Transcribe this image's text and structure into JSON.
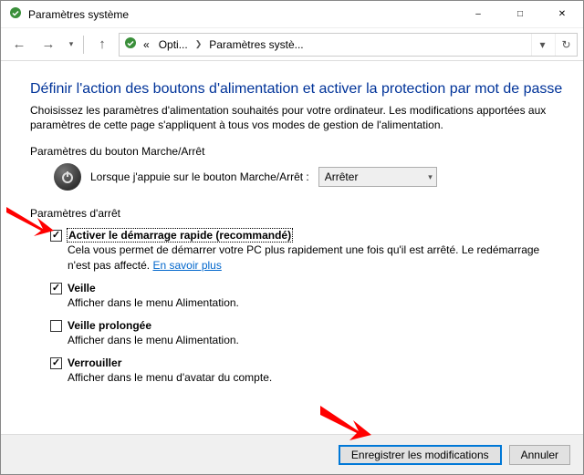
{
  "window": {
    "title": "Paramètres système"
  },
  "breadcrumb": {
    "item0": "Opti...",
    "item1": "Paramètres systè..."
  },
  "page": {
    "heading": "Définir l'action des boutons d'alimentation et activer la protection par mot de passe",
    "intro": "Choisissez les paramètres d'alimentation souhaités pour votre ordinateur. Les modifications apportées aux paramètres de cette page s'appliquent à tous vos modes de gestion de l'alimentation."
  },
  "powerButton": {
    "sectionLabel": "Paramètres du bouton Marche/Arrêt",
    "rowLabel": "Lorsque j'appuie sur le bouton Marche/Arrêt :",
    "selected": "Arrêter"
  },
  "shutdown": {
    "sectionLabel": "Paramètres d'arrêt",
    "opt0": {
      "checked": true,
      "label": "Activer le démarrage rapide (recommandé)",
      "desc_before": "Cela vous permet de démarrer votre PC plus rapidement une fois qu'il est arrêté. Le redémarrage n'est pas affecté. ",
      "link": "En savoir plus"
    },
    "opt1": {
      "checked": true,
      "label": "Veille",
      "desc": "Afficher dans le menu Alimentation."
    },
    "opt2": {
      "checked": false,
      "label": "Veille prolongée",
      "desc": "Afficher dans le menu Alimentation."
    },
    "opt3": {
      "checked": true,
      "label": "Verrouiller",
      "desc": "Afficher dans le menu d'avatar du compte."
    }
  },
  "footer": {
    "save": "Enregistrer les modifications",
    "cancel": "Annuler"
  }
}
